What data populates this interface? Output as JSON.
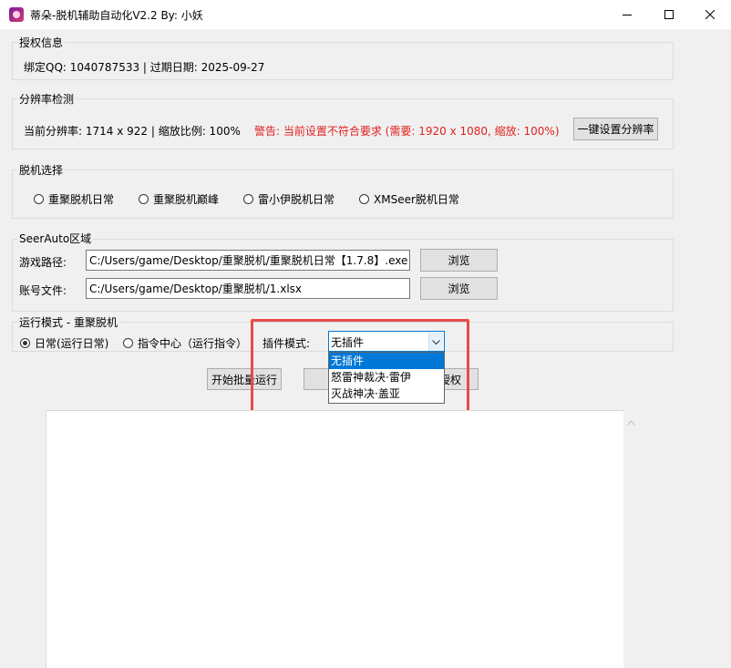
{
  "window": {
    "title": "蒂朵-脱机辅助自动化V2.2 By: 小妖",
    "accent": "#0078d7",
    "warning_color": "#e0211f",
    "highlight_color": "#e84b4b"
  },
  "license": {
    "group_title": "授权信息",
    "info": "绑定QQ: 1040787533 | 过期日期: 2025-09-27"
  },
  "resolution": {
    "group_title": "分辨率检测",
    "current": "当前分辨率: 1714 x 922 | 缩放比例: 100%",
    "warning": "警告: 当前设置不符合要求 (需要: 1920 x 1080, 缩放: 100%)",
    "set_button": "一键设置分辨率"
  },
  "offline_select": {
    "group_title": "脱机选择",
    "options": [
      "重聚脱机日常",
      "重聚脱机巅峰",
      "雷小伊脱机日常",
      "XMSeer脱机日常"
    ]
  },
  "seerauto": {
    "group_title": "SeerAuto区域",
    "game_path_label": "游戏路径:",
    "game_path_value": "C:/Users/game/Desktop/重聚脱机/重聚脱机日常【1.7.8】.exe",
    "account_file_label": "账号文件:",
    "account_file_value": "C:/Users/game/Desktop/重聚脱机/1.xlsx",
    "browse_label": "浏览"
  },
  "run_mode": {
    "group_title": "运行模式 - 重聚脱机",
    "options": [
      "日常(运行日常)",
      "指令中心（运行指令）"
    ],
    "selected_index": 0,
    "plugin_label": "插件模式:",
    "plugin_value": "无插件",
    "plugin_options": [
      "无插件",
      "怒雷神裁决·雷伊",
      "灭战神决·盖亚"
    ]
  },
  "actions": {
    "start_batch_partial": "开始批量运行",
    "auth_partial": "授权"
  },
  "icons": {
    "minimize": "minimize-icon",
    "maximize": "maximize-icon",
    "close": "close-icon",
    "dropdown": "chevron-down-icon",
    "scroll_up": "scroll-up-arrow-icon"
  }
}
